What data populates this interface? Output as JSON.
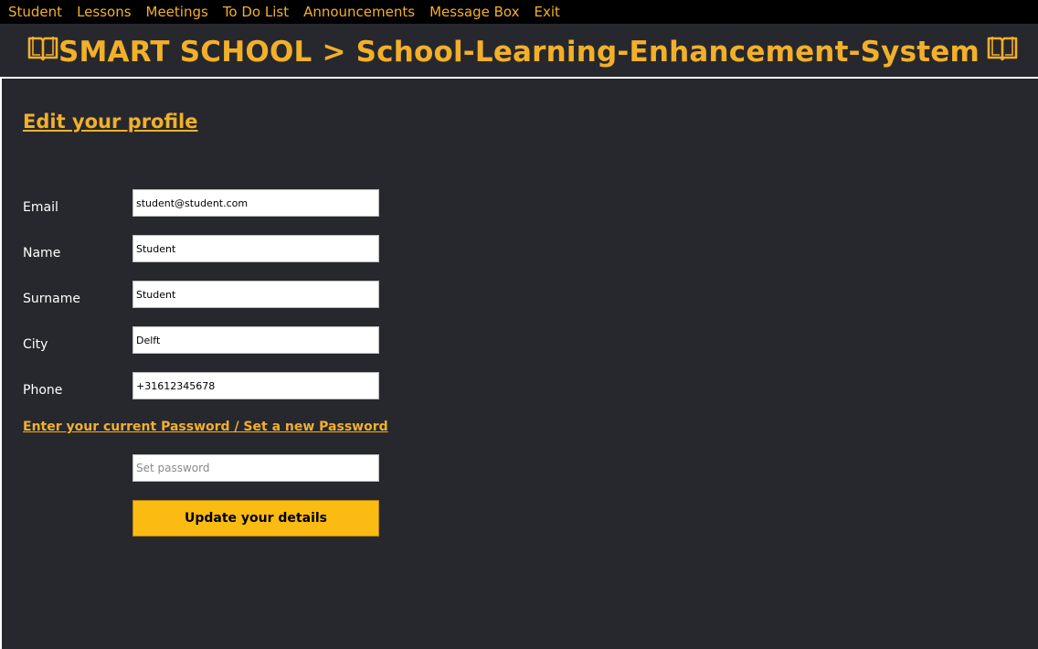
{
  "menu": {
    "items": [
      {
        "label": "Student"
      },
      {
        "label": "Lessons"
      },
      {
        "label": "Meetings"
      },
      {
        "label": "To Do List"
      },
      {
        "label": "Announcements"
      },
      {
        "label": "Message Box"
      },
      {
        "label": "Exit"
      }
    ]
  },
  "header": {
    "title": "SMART SCHOOL > School-Learning-Enhancement-System",
    "left_icon": "book-icon",
    "right_icon": "book-icon"
  },
  "main": {
    "page_title": "Edit your profile",
    "fields": [
      {
        "label": "Email",
        "value": "student@student.com"
      },
      {
        "label": "Name",
        "value": "Student"
      },
      {
        "label": "Surname",
        "value": "Student"
      },
      {
        "label": "City",
        "value": "Delft"
      },
      {
        "label": "Phone",
        "value": "+31612345678"
      }
    ],
    "password_section_label": "Enter your current Password / Set a new Password",
    "password_placeholder": "Set password",
    "update_button_label": "Update your details"
  },
  "colors": {
    "accent": "#f2b02a",
    "button": "#fbbb13",
    "background": "#27282d",
    "menubar": "#000000"
  }
}
